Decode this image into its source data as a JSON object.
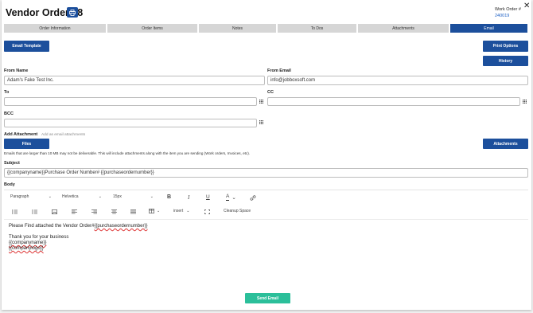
{
  "header": {
    "title": "Vendor Order #8",
    "work_order_label": "Work Order #",
    "work_order_number": "240019"
  },
  "tabs": [
    {
      "label": "Order Information"
    },
    {
      "label": "Order Items"
    },
    {
      "label": "Notes"
    },
    {
      "label": "To Dos"
    },
    {
      "label": "Attachments"
    },
    {
      "label": "Email",
      "active": true
    }
  ],
  "actions": {
    "email_template": "Email Template",
    "print_options": "Print Options",
    "history": "History",
    "files": "Files",
    "attachments": "Attachments",
    "send_email": "Send Email"
  },
  "form": {
    "from_name_label": "From Name",
    "from_name_value": "Adam's Fake Test Inc.",
    "from_email_label": "From Email",
    "from_email_value": "info@jobboxsoft.com",
    "to_label": "To",
    "to_value": "",
    "cc_label": "CC",
    "cc_value": "",
    "bcc_label": "BCC",
    "bcc_value": "",
    "add_attachment_label": "Add Attachment",
    "add_attachment_hint": "Add as email attachments",
    "size_note": "Emails that are larger than 10 MB may not be deliverable. This will include attachments along with the item you are sending (Work orders, Invoices, etc).",
    "subject_label": "Subject",
    "subject_value": "{{companyname}}Purchase Order Number# {{purchaseordernumber}}",
    "body_label": "Body"
  },
  "toolbar": {
    "block_format": "Paragraph",
    "font_family": "Helvetica",
    "font_size": "15px",
    "insert": "insert",
    "cleanup": "Cleanup Space"
  },
  "body": {
    "line1_prefix": "Please Find attached the Vendor Order#",
    "line1_tag": "{{purchaseordernumber}}",
    "line2": "Thank you for your business",
    "line3": "{{companyname}}",
    "line4": "{{companylogo}}"
  },
  "colors": {
    "primary": "#1c4f9c",
    "send": "#2bbf9a",
    "link": "#1c5fc4"
  }
}
